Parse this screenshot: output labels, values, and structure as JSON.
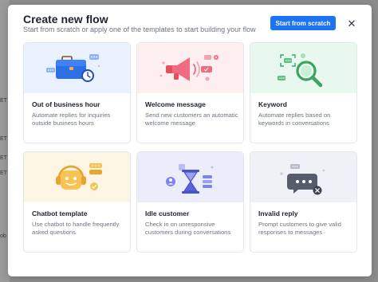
{
  "modal": {
    "title": "Create new flow",
    "subtitle": "Start from scratch or apply one of the templates to start building your flow",
    "start_button": "Start from scratch",
    "close_icon": "close-icon"
  },
  "backdrop": {
    "fragments": [
      "ET",
      "ET",
      "ET",
      "ET",
      "ob"
    ]
  },
  "cards": [
    {
      "title": "Out of business hour",
      "description": "Automate replies for inquiries outside business hours",
      "illustration_bg": "#eaf1fe",
      "icon": "briefcase-clock-icon"
    },
    {
      "title": "Welcome message",
      "description": "Send new customers an automatic welcome message",
      "illustration_bg": "#fdeef0",
      "icon": "megaphone-icon"
    },
    {
      "title": "Keyword",
      "description": "Automate replies based on keywords in conversations",
      "illustration_bg": "#e9f8ee",
      "icon": "magnifier-icon"
    },
    {
      "title": "Chatbot template",
      "description": "Use chatbot to handle frequently asked questions",
      "illustration_bg": "#fdf5e4",
      "icon": "chatbot-icon"
    },
    {
      "title": "Idle customer",
      "description": "Check in on unresponsive customers during conversations",
      "illustration_bg": "#ecedfb",
      "icon": "hourglass-icon"
    },
    {
      "title": "Invalid reply",
      "description": "Prompt customers to give valid responses to messages",
      "illustration_bg": "#eef1f5",
      "icon": "chat-error-icon"
    }
  ],
  "colors": {
    "primary": "#1e73f5",
    "backdrop": "#8c8c8c"
  }
}
